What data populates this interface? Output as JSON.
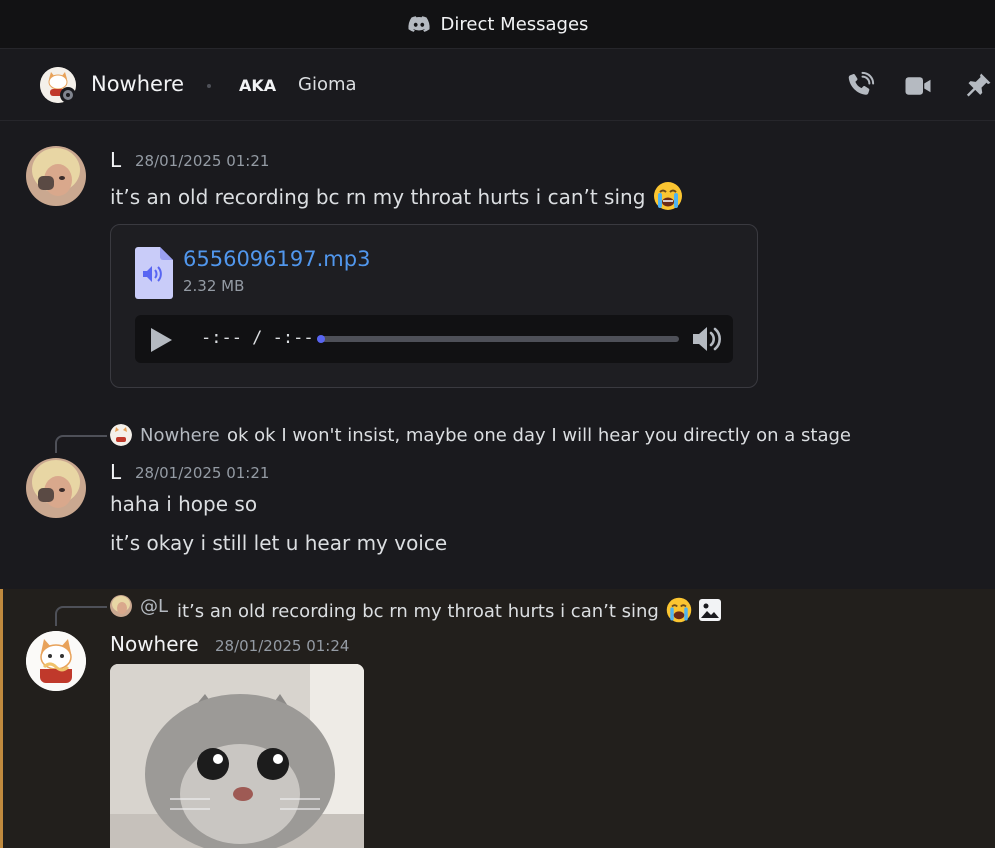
{
  "titlebar": {
    "title": "Direct Messages",
    "icon": "discord-icon"
  },
  "header": {
    "name": "Nowhere",
    "aka_label": "AKA",
    "alias": "Gioma",
    "icons": [
      "phone-call-icon",
      "video-call-icon",
      "pin-icon"
    ]
  },
  "messages": [
    {
      "author": "L",
      "time": "28/01/2025 01:21",
      "text": "it’s an old recording bc rn my throat hurts i can’t sing",
      "emoji": "loudly-crying-emoji",
      "attachment": {
        "filename": "6556096197.mp3",
        "size": "2.32 MB",
        "player_time": "-:-- / -:--",
        "progress": 0.02
      }
    },
    {
      "reply": {
        "name": "Nowhere",
        "text": "ok ok I won't insist, maybe one day I will hear you directly on a stage"
      },
      "author": "L",
      "time": "28/01/2025 01:21",
      "lines": [
        "haha i hope so",
        "it’s okay i still let u hear my voice"
      ]
    },
    {
      "reply": {
        "name": "@L",
        "text": "it’s an old recording bc rn my throat hurts i can’t sing",
        "emoji": "loudly-crying-emoji",
        "image_icon": "image-icon"
      },
      "author": "Nowhere",
      "time": "28/01/2025 01:24",
      "image": "surprised-cat-image"
    }
  ],
  "colors": {
    "link": "#5197ed",
    "accent": "#5865f2",
    "highlight_bar": "#c08a3e"
  }
}
